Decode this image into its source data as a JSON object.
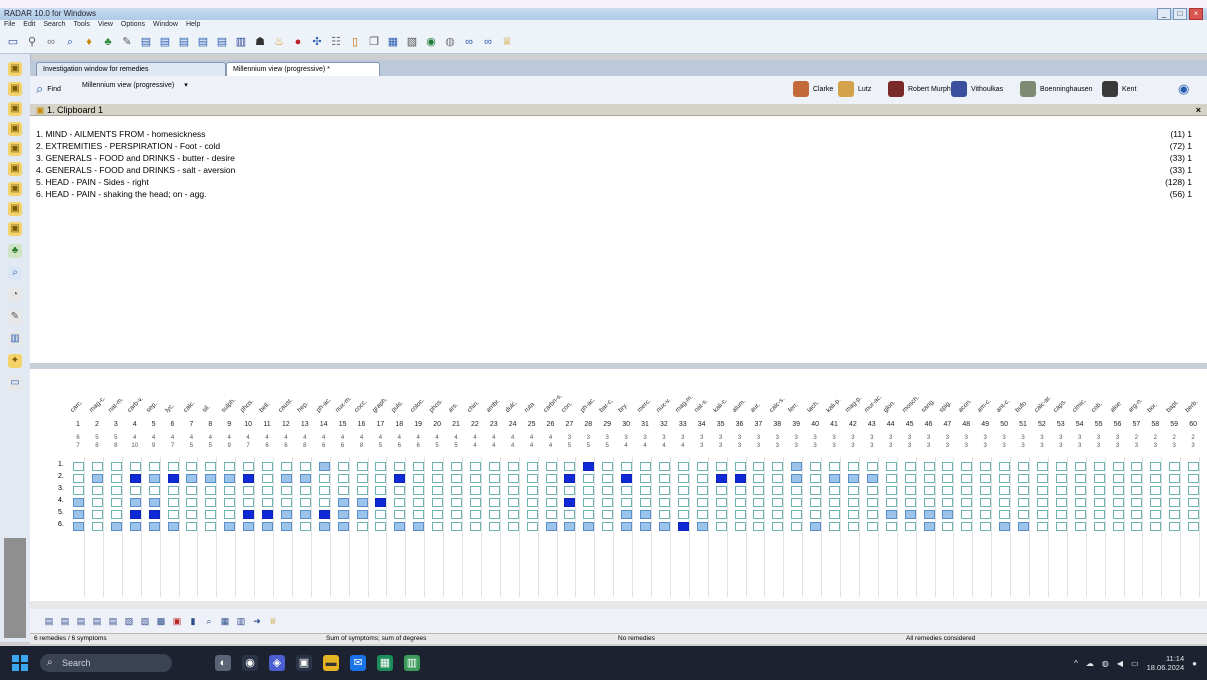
{
  "window": {
    "title": "RADAR 10.0 for Windows",
    "controls": [
      "_",
      "□",
      "×"
    ]
  },
  "menu": [
    "File",
    "Edit",
    "Search",
    "Tools",
    "View",
    "Options",
    "Window",
    "Help"
  ],
  "tabs": [
    {
      "label": "Investigation window for remedies"
    },
    {
      "label": "Millennium view (progressive) *"
    }
  ],
  "remedy_bar": {
    "find_label": "Find",
    "view_label": "Millennium view (progressive)",
    "authors": [
      "Clarke",
      "Lutz",
      "Robert Murphy",
      "Vithoulkas",
      "Boenninghausen",
      "Kent"
    ]
  },
  "clipboard": {
    "title": "1. Clipboard 1",
    "close": "×",
    "rubrics": [
      {
        "text": "1. MIND - AILMENTS FROM - homesickness",
        "count": "(11) 1"
      },
      {
        "text": "2. EXTREMITIES - PERSPIRATION - Foot - cold",
        "count": "(72) 1"
      },
      {
        "text": "3. GENERALS - FOOD and DRINKS - butter - desire",
        "count": "(33) 1"
      },
      {
        "text": "4. GENERALS - FOOD and DRINKS - salt - aversion",
        "count": "(33) 1"
      },
      {
        "text": "5. HEAD - PAIN - Sides - right",
        "count": "(128) 1"
      },
      {
        "text": "6. HEAD - PAIN - shaking the head; on - agg.",
        "count": "(56) 1"
      }
    ]
  },
  "grid": {
    "remedies": [
      "carc.",
      "mag-c.",
      "nat-m.",
      "carb-v.",
      "sep.",
      "lyc.",
      "calc.",
      "sil.",
      "sulph.",
      "phos.",
      "bell.",
      "caust.",
      "hep.",
      "ph-ac.",
      "nux-m.",
      "cocc.",
      "graph.",
      "puls.",
      "coloc.",
      "phos.",
      "ars.",
      "chin.",
      "ambr.",
      "dulc.",
      "ruta",
      "carbn-s.",
      "con.",
      "ph-ac.",
      "bar-c.",
      "bry.",
      "merc.",
      "nux-v.",
      "mag-m.",
      "nat-s.",
      "kali-c.",
      "alum.",
      "aur.",
      "calc-s.",
      "ferr.",
      "lach.",
      "kali-p.",
      "mag-p.",
      "mur-ac.",
      "glon.",
      "mosch.",
      "sang.",
      "spig.",
      "acon.",
      "am-c.",
      "ant-c.",
      "bufo",
      "calc-ar.",
      "caps.",
      "cimic.",
      "cob.",
      "aloe",
      "arg-n.",
      "bor.",
      "bapt.",
      "berb."
    ],
    "col_numbers": [
      "1",
      "2",
      "3",
      "4",
      "5",
      "6",
      "7",
      "8",
      "9",
      "10",
      "11",
      "12",
      "13",
      "14",
      "15",
      "16",
      "17",
      "18",
      "19",
      "20",
      "21",
      "22",
      "23",
      "24",
      "25",
      "26",
      "27",
      "28",
      "29",
      "30",
      "31",
      "32",
      "33",
      "34",
      "35",
      "36",
      "37",
      "38",
      "39",
      "40",
      "41",
      "42",
      "43",
      "44",
      "45",
      "46",
      "47",
      "48",
      "49",
      "50",
      "51",
      "52",
      "53",
      "54",
      "55",
      "56",
      "57",
      "58",
      "59",
      "60"
    ],
    "scores": [
      "6",
      "5",
      "5",
      "4",
      "4",
      "4",
      "4",
      "4",
      "4",
      "4",
      "4",
      "4",
      "4",
      "4",
      "4",
      "4",
      "4",
      "4",
      "4",
      "4",
      "4",
      "4",
      "4",
      "4",
      "4",
      "4",
      "3",
      "3",
      "3",
      "3",
      "3",
      "3",
      "3",
      "3",
      "3",
      "3",
      "3",
      "3",
      "3",
      "3",
      "3",
      "3",
      "3",
      "3",
      "3",
      "3",
      "3",
      "3",
      "3",
      "3",
      "3",
      "3",
      "3",
      "3",
      "3",
      "3",
      "2",
      "2",
      "2",
      "2"
    ],
    "hits": [
      "7",
      "8",
      "8",
      "10",
      "9",
      "7",
      "5",
      "5",
      "9",
      "7",
      "6",
      "6",
      "8",
      "6",
      "6",
      "8",
      "5",
      "6",
      "6",
      "5",
      "5",
      "4",
      "4",
      "4",
      "4",
      "4",
      "5",
      "5",
      "5",
      "4",
      "4",
      "4",
      "4",
      "3",
      "3",
      "3",
      "3",
      "3",
      "3",
      "3",
      "3",
      "3",
      "3",
      "3",
      "3",
      "3",
      "3",
      "3",
      "3",
      "3",
      "3",
      "3",
      "3",
      "3",
      "3",
      "3",
      "3",
      "3",
      "3",
      "3"
    ],
    "row_labels": [
      "1.",
      "2.",
      "3.",
      "4.",
      "5.",
      "6."
    ],
    "rows": [
      [
        1,
        0,
        0,
        0,
        0,
        0,
        0,
        0,
        0,
        0,
        0,
        0,
        0,
        2,
        0,
        0,
        0,
        0,
        0,
        0,
        0,
        0,
        0,
        0,
        0,
        0,
        0,
        3,
        0,
        0,
        0,
        0,
        0,
        0,
        0,
        0,
        0,
        0,
        2,
        0,
        0,
        0,
        0,
        1,
        0,
        0,
        0,
        0,
        0,
        0,
        0,
        0,
        0,
        0,
        0,
        0,
        0,
        0,
        0,
        0
      ],
      [
        1,
        2,
        1,
        3,
        2,
        3,
        2,
        2,
        2,
        3,
        1,
        2,
        2,
        0,
        0,
        0,
        1,
        3,
        1,
        1,
        1,
        0,
        1,
        1,
        0,
        0,
        3,
        0,
        0,
        3,
        0,
        0,
        0,
        0,
        3,
        3,
        0,
        1,
        2,
        0,
        2,
        2,
        2,
        1,
        0,
        0,
        1,
        0,
        0,
        0,
        1,
        0,
        1,
        1,
        0,
        1,
        0,
        0,
        0,
        0
      ],
      [
        1,
        0,
        0,
        0,
        0,
        0,
        0,
        0,
        1,
        0,
        0,
        0,
        0,
        1,
        0,
        0,
        0,
        0,
        0,
        0,
        0,
        1,
        0,
        0,
        1,
        1,
        0,
        0,
        0,
        0,
        0,
        0,
        0,
        0,
        0,
        0,
        0,
        0,
        0,
        1,
        0,
        0,
        0,
        0,
        0,
        0,
        0,
        0,
        0,
        1,
        0,
        0,
        0,
        0,
        0,
        0,
        0,
        0,
        0,
        1
      ],
      [
        2,
        0,
        0,
        2,
        2,
        1,
        1,
        1,
        0,
        0,
        0,
        0,
        0,
        0,
        2,
        2,
        3,
        0,
        1,
        0,
        1,
        0,
        0,
        1,
        0,
        0,
        3,
        0,
        0,
        0,
        0,
        0,
        1,
        0,
        0,
        0,
        0,
        0,
        0,
        0,
        0,
        0,
        0,
        0,
        0,
        0,
        0,
        0,
        0,
        0,
        1,
        0,
        0,
        0,
        0,
        1,
        1,
        0,
        0,
        1
      ],
      [
        2,
        1,
        1,
        3,
        3,
        1,
        0,
        1,
        1,
        3,
        3,
        2,
        2,
        3,
        2,
        2,
        0,
        1,
        0,
        0,
        1,
        0,
        1,
        1,
        1,
        0,
        0,
        0,
        1,
        2,
        2,
        0,
        1,
        0,
        1,
        1,
        0,
        0,
        0,
        1,
        0,
        0,
        1,
        2,
        2,
        2,
        2,
        1,
        0,
        1,
        0,
        1,
        1,
        1,
        1,
        1,
        1,
        1,
        1,
        0
      ],
      [
        2,
        1,
        2,
        2,
        2,
        2,
        1,
        1,
        2,
        2,
        2,
        2,
        1,
        2,
        2,
        0,
        1,
        2,
        2,
        1,
        1,
        0,
        0,
        0,
        0,
        2,
        2,
        2,
        1,
        2,
        2,
        2,
        3,
        2,
        1,
        0,
        0,
        0,
        1,
        2,
        0,
        0,
        0,
        0,
        0,
        2,
        0,
        0,
        1,
        2,
        2,
        1,
        0,
        1,
        0,
        0,
        0,
        0,
        1,
        1
      ]
    ]
  },
  "status": {
    "s1": "6 remedies / 6 symptoms",
    "s2": "Sum of symptoms; sum of degrees",
    "s3": "No remedies",
    "s4": "All remedies considered"
  },
  "taskbar": {
    "search_placeholder": "Search",
    "time": "11:14",
    "date": "18.06.2024"
  }
}
